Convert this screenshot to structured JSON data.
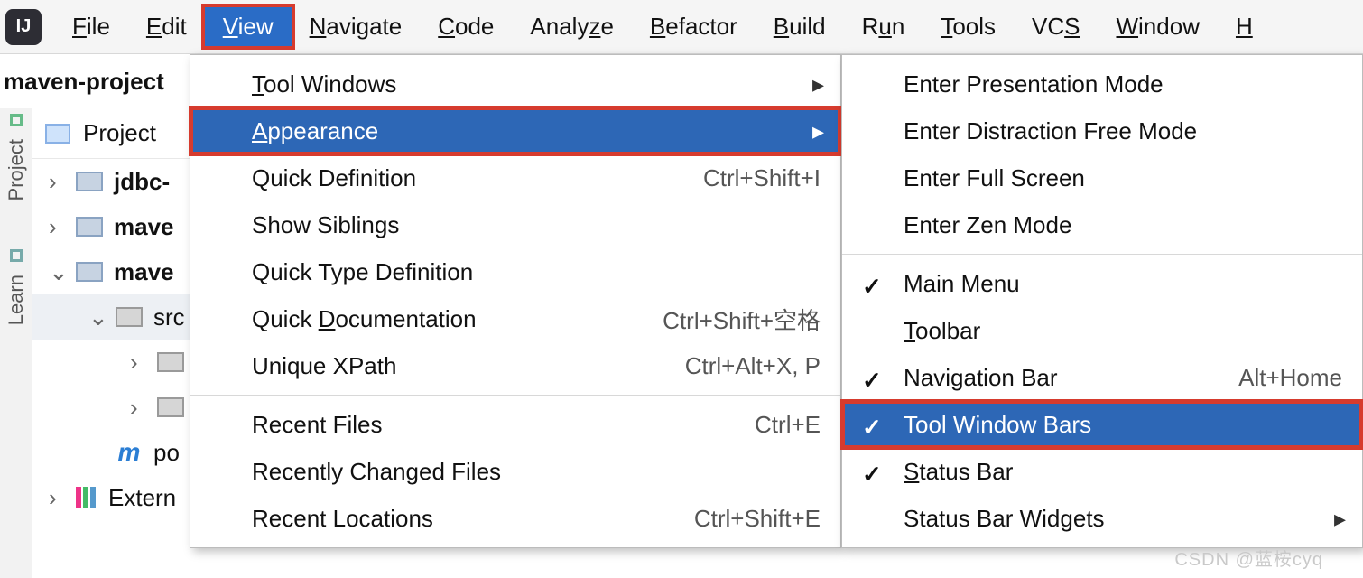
{
  "app_icon_letters": "IJ",
  "menubar": {
    "items": [
      {
        "pre": "",
        "mn": "F",
        "post": "ile"
      },
      {
        "pre": "",
        "mn": "E",
        "post": "dit"
      },
      {
        "pre": "",
        "mn": "V",
        "post": "iew"
      },
      {
        "pre": "",
        "mn": "N",
        "post": "avigate"
      },
      {
        "pre": "",
        "mn": "C",
        "post": "ode"
      },
      {
        "pre": "Analy",
        "mn": "z",
        "post": "e"
      },
      {
        "pre": "",
        "mn": "R",
        "post": "efactor"
      },
      {
        "pre": "",
        "mn": "B",
        "post": "uild"
      },
      {
        "pre": "R",
        "mn": "u",
        "post": "n"
      },
      {
        "pre": "",
        "mn": "T",
        "post": "ools"
      },
      {
        "pre": "VC",
        "mn": "S",
        "post": ""
      },
      {
        "pre": "",
        "mn": "W",
        "post": "indow"
      },
      {
        "pre": "",
        "mn": "H",
        "post": ""
      }
    ]
  },
  "breadcrumb": "maven-project",
  "stripe": {
    "panel1": "Project",
    "panel2": "Learn"
  },
  "tree": {
    "header": "Project",
    "rows": [
      {
        "chev": "›",
        "name": "jdbc-",
        "indent": 0
      },
      {
        "chev": "›",
        "name": "mave",
        "indent": 0
      },
      {
        "chev": "⌄",
        "name": "mave",
        "indent": 0
      },
      {
        "chev": "⌄",
        "name": "src",
        "indent": 1
      },
      {
        "chev": "›",
        "name": "",
        "indent": 2
      },
      {
        "chev": "›",
        "name": "",
        "indent": 2
      },
      {
        "chev": "",
        "name": "po",
        "indent": 1,
        "m": true
      },
      {
        "chev": "›",
        "name": "Extern",
        "indent": 0,
        "lib": true
      }
    ]
  },
  "menu1": {
    "items": [
      {
        "pre": "",
        "mn": "T",
        "post": "ool Windows",
        "sub": true
      },
      {
        "pre": "",
        "mn": "A",
        "post": "ppearance",
        "sub": true,
        "hl": true
      },
      {
        "pre": "Quick Definition",
        "shortcut": "Ctrl+Shift+I"
      },
      {
        "pre": "Show Siblings"
      },
      {
        "pre": "Quick Type Definition"
      },
      {
        "pre": "Quick ",
        "mn": "D",
        "post": "ocumentation",
        "shortcut": "Ctrl+Shift+空格"
      },
      {
        "pre": "Unique XPath",
        "shortcut": "Ctrl+Alt+X, P"
      },
      {
        "sep": true
      },
      {
        "pre": "Recent Files",
        "shortcut": "Ctrl+E"
      },
      {
        "pre": "Recently Changed Files"
      },
      {
        "pre": "Recent Locations",
        "shortcut": "Ctrl+Shift+E"
      }
    ]
  },
  "menu2": {
    "items": [
      {
        "pre": "Enter Presentation Mode"
      },
      {
        "pre": "Enter Distraction Free Mode"
      },
      {
        "pre": "Enter Full Screen"
      },
      {
        "pre": "Enter Zen Mode"
      },
      {
        "sep": true
      },
      {
        "pre": "Main Menu",
        "check": true
      },
      {
        "pre": "",
        "mn": "T",
        "post": "oolbar"
      },
      {
        "pre": "Navi",
        "mn": "g",
        "post": "ation Bar",
        "shortcut": "Alt+Home",
        "check": true
      },
      {
        "pre": "Tool Window Bars",
        "check": true,
        "hl": true
      },
      {
        "pre": "",
        "mn": "S",
        "post": "tatus Bar",
        "check": true
      },
      {
        "pre": "Status Bar Widgets",
        "sub": true
      }
    ]
  },
  "watermark": "CSDN @蓝桉cyq"
}
